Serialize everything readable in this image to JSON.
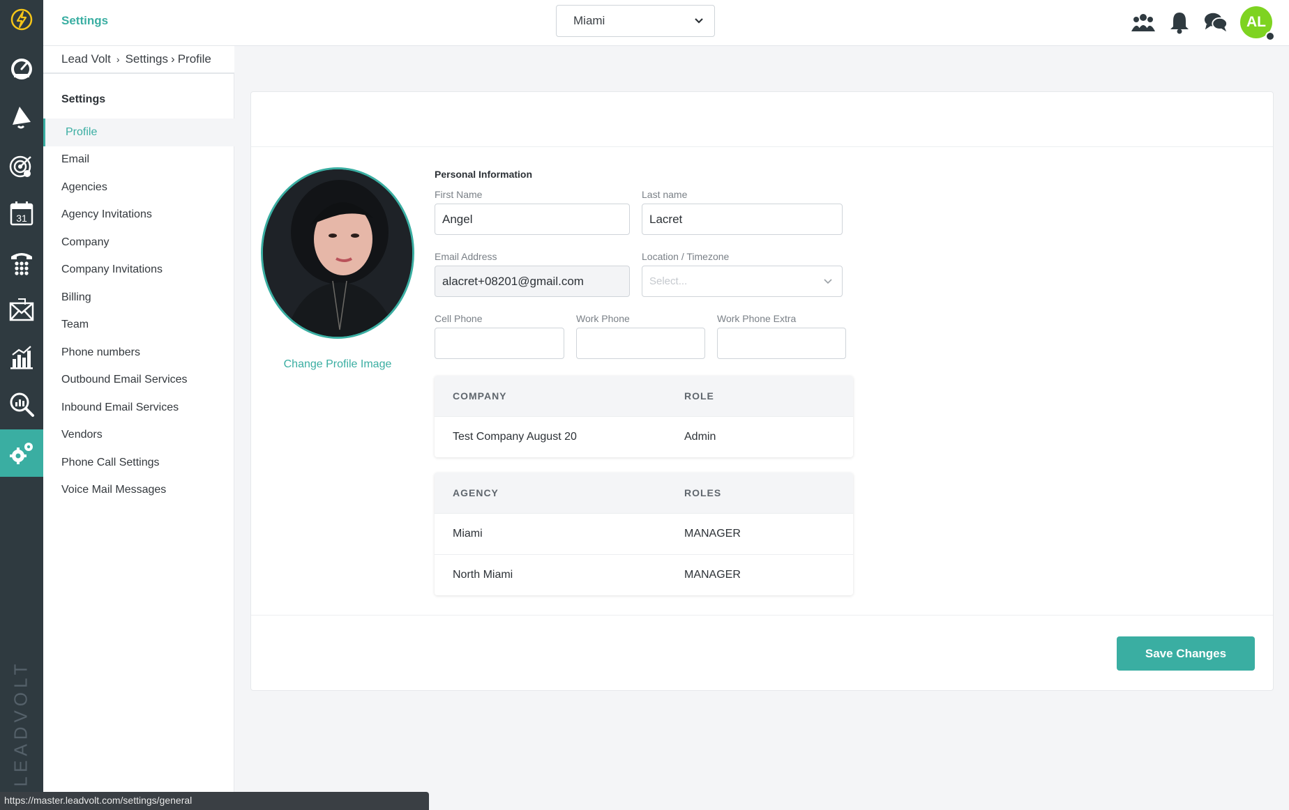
{
  "topbar": {
    "title": "Settings",
    "agency_select": "Miami",
    "avatar_initials": "AL"
  },
  "breadcrumb": {
    "root": "Lead Volt",
    "sep1": "›",
    "mid": "Settings",
    "sep2": "›",
    "current": "Profile"
  },
  "rail": {
    "brand": "LEADVOLT",
    "items": [
      "dashboard-icon",
      "campaigns-icon",
      "leads-target-icon",
      "calendar-icon",
      "phone-icon",
      "mail-icon",
      "reports-icon",
      "analytics-search-icon",
      "settings-icon"
    ],
    "calendar_day": "31"
  },
  "submenu": {
    "heading": "Settings",
    "items": [
      {
        "label": "Profile"
      },
      {
        "label": "Email"
      },
      {
        "label": "Agencies"
      },
      {
        "label": "Agency Invitations"
      },
      {
        "label": "Company"
      },
      {
        "label": "Company Invitations"
      },
      {
        "label": "Billing"
      },
      {
        "label": "Team"
      },
      {
        "label": "Phone numbers"
      },
      {
        "label": "Outbound Email Services"
      },
      {
        "label": "Inbound Email Services"
      },
      {
        "label": "Vendors"
      },
      {
        "label": "Phone Call Settings"
      },
      {
        "label": "Voice Mail Messages"
      }
    ]
  },
  "profile": {
    "change_image": "Change Profile Image",
    "section_title": "Personal Information",
    "first_name_label": "First Name",
    "first_name": "Angel",
    "last_name_label": "Last name",
    "last_name": "Lacret",
    "email_label": "Email Address",
    "email": "alacret+08201@gmail.com",
    "location_label": "Location / Timezone",
    "location_placeholder": "Select...",
    "cell_label": "Cell Phone",
    "cell": "",
    "work_label": "Work Phone",
    "work": "",
    "work_extra_label": "Work Phone Extra",
    "work_extra": ""
  },
  "company_table": {
    "headers": [
      "COMPANY",
      "ROLE"
    ],
    "rows": [
      [
        "Test Company August 20",
        "Admin"
      ]
    ]
  },
  "agency_table": {
    "headers": [
      "AGENCY",
      "ROLES"
    ],
    "rows": [
      [
        "Miami",
        "MANAGER"
      ],
      [
        "North Miami",
        "MANAGER"
      ]
    ]
  },
  "actions": {
    "save": "Save Changes"
  },
  "status_url": "https://master.leadvolt.com/settings/general",
  "colors": {
    "accent": "#3aaea2",
    "rail": "#2f3a40",
    "avatar": "#7ed321"
  }
}
